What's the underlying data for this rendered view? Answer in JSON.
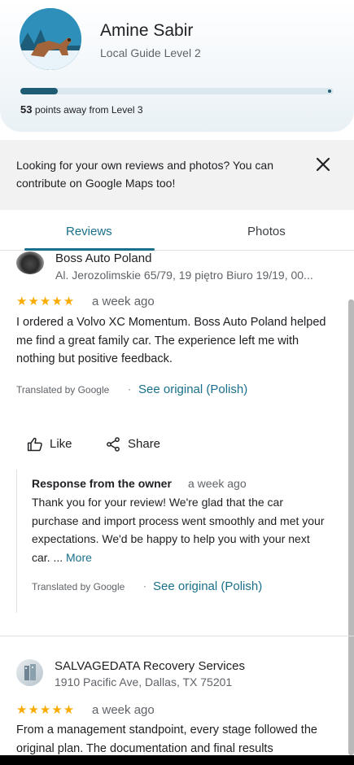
{
  "profile": {
    "name": "Amine Sabir",
    "level": "Local Guide Level 2",
    "points_bold": "53",
    "points_rest": "points away from Level 3",
    "progress_fraction": 0.12
  },
  "banner": {
    "text": "Looking for your own reviews and photos? You can contribute on Google Maps too!"
  },
  "tabs": [
    {
      "label": "Reviews",
      "active": true
    },
    {
      "label": "Photos",
      "active": false
    }
  ],
  "reviews": [
    {
      "business": "Boss Auto Poland",
      "address": "Al. Jerozolimskie 65/79, 19 piętro Biuro 19/19, 00...",
      "stars": "★★★★★",
      "when": "a week ago",
      "text": "I ordered a Volvo XC Momentum. Boss Auto Poland helped me find a great family car. The experience left me with nothing but positive feedback.",
      "translated": "Translated by Google",
      "separator": "·",
      "see_original": "See original (Polish)",
      "like_label": "Like",
      "share_label": "Share",
      "response": {
        "title": "Response from the owner",
        "when": "a week ago",
        "text": "Thank you for your review! We're glad that the car purchase and import process went smoothly and met your expectations. We'd be happy to help you with your next car. ...",
        "more": "More",
        "translated": "Translated by Google",
        "separator": "·",
        "see_original": "See original (Polish)"
      }
    },
    {
      "business": "SALVAGEDATA Recovery Services",
      "address": "1910 Pacific Ave, Dallas, TX 75201",
      "stars": "★★★★★",
      "when": "a week ago",
      "text": "From a management standpoint, every stage followed the original plan. The documentation and final results"
    }
  ],
  "colors": {
    "accent": "#1a6f8a",
    "star": "#f9ab00",
    "progress": "#1f5c73"
  }
}
